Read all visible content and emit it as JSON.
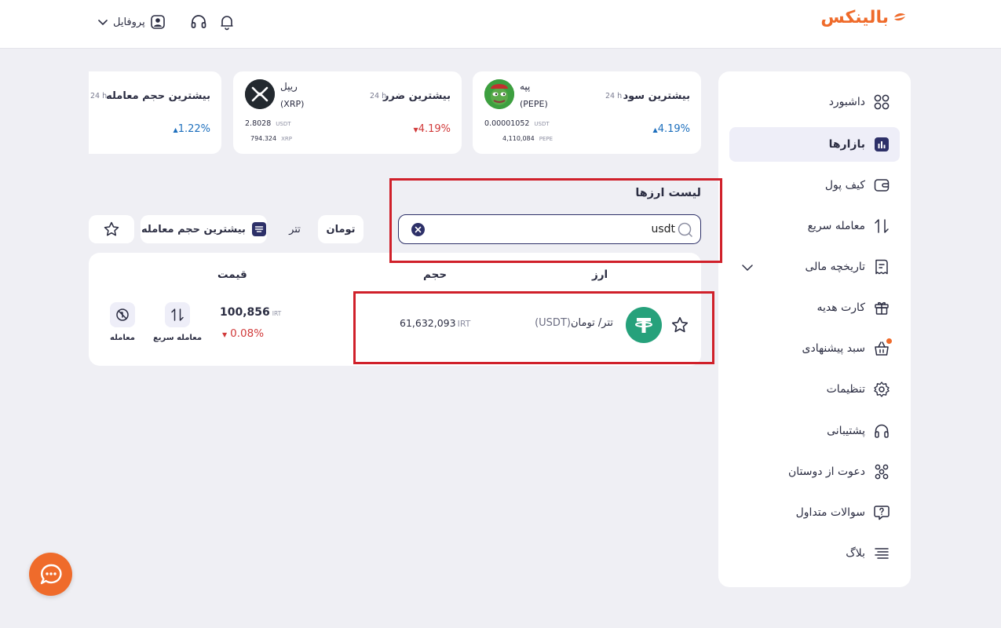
{
  "header": {
    "logo_text": "بالینکس",
    "profile_label": "پروفایل"
  },
  "sidebar": {
    "items": [
      {
        "label": "داشبورد",
        "icon": "dashboard-grid-icon"
      },
      {
        "label": "بازارها",
        "icon": "markets-chart-icon",
        "active": true
      },
      {
        "label": "کیف پول",
        "icon": "wallet-icon"
      },
      {
        "label": "معامله سریع",
        "icon": "swap-arrows-icon"
      },
      {
        "label": "تاریخچه مالی",
        "icon": "receipt-icon",
        "expandable": true
      },
      {
        "label": "کارت هدیه",
        "icon": "gift-icon"
      },
      {
        "label": "سبد پیشنهادی",
        "icon": "basket-icon",
        "badge": true
      },
      {
        "label": "تنظیمات",
        "icon": "gear-icon"
      },
      {
        "label": "پشتیبانی",
        "icon": "headset-icon"
      },
      {
        "label": "دعوت از دوستان",
        "icon": "invite-friends-icon"
      },
      {
        "label": "سوالات متداول",
        "icon": "faq-icon"
      },
      {
        "label": "بلاگ",
        "icon": "blog-lines-icon"
      }
    ]
  },
  "stats": [
    {
      "title": "بیشترین سود",
      "period": "24 h",
      "coin_name": "پپه",
      "coin_symbol": "(PEPE)",
      "price": "0.00001052",
      "price_unit": "USDT",
      "volume": "4,110,084",
      "volume_unit": "PEPE",
      "change": "4.19%",
      "direction": "up"
    },
    {
      "title": "بیشترین ضرر",
      "period": "24 h",
      "coin_name": "ریپل",
      "coin_symbol": "(XRP)",
      "price": "2.8028",
      "price_unit": "USDT",
      "volume": "794.324",
      "volume_unit": "XRP",
      "change": "4.19%",
      "direction": "down"
    },
    {
      "title": "بیشترین حجم معامله",
      "period": "24 h",
      "change": "1.22%",
      "direction": "up"
    }
  ],
  "currency_list": {
    "title": "لیست ارزها",
    "search_value": "usdt",
    "filters": {
      "toman": "تومان",
      "tether": "تتر",
      "sort": "بیشترین حجم معامله"
    },
    "columns": {
      "currency": "ارز",
      "volume": "حجم",
      "price": "قیمت"
    },
    "rows": [
      {
        "name": "تتر/ تومان",
        "symbol": "(USDT)",
        "volume": "61,632,093",
        "volume_unit": "IRT",
        "price": "100,856",
        "price_unit": "IRT",
        "change": "0.08%",
        "direction": "down",
        "action_quick": "معامله سریع",
        "action_trade": "معامله"
      }
    ]
  },
  "colors": {
    "accent": "#ef6b2b",
    "navy": "#2d3068",
    "up": "#1d6fbd",
    "down": "#d13a3a",
    "highlight": "#d0202a"
  }
}
